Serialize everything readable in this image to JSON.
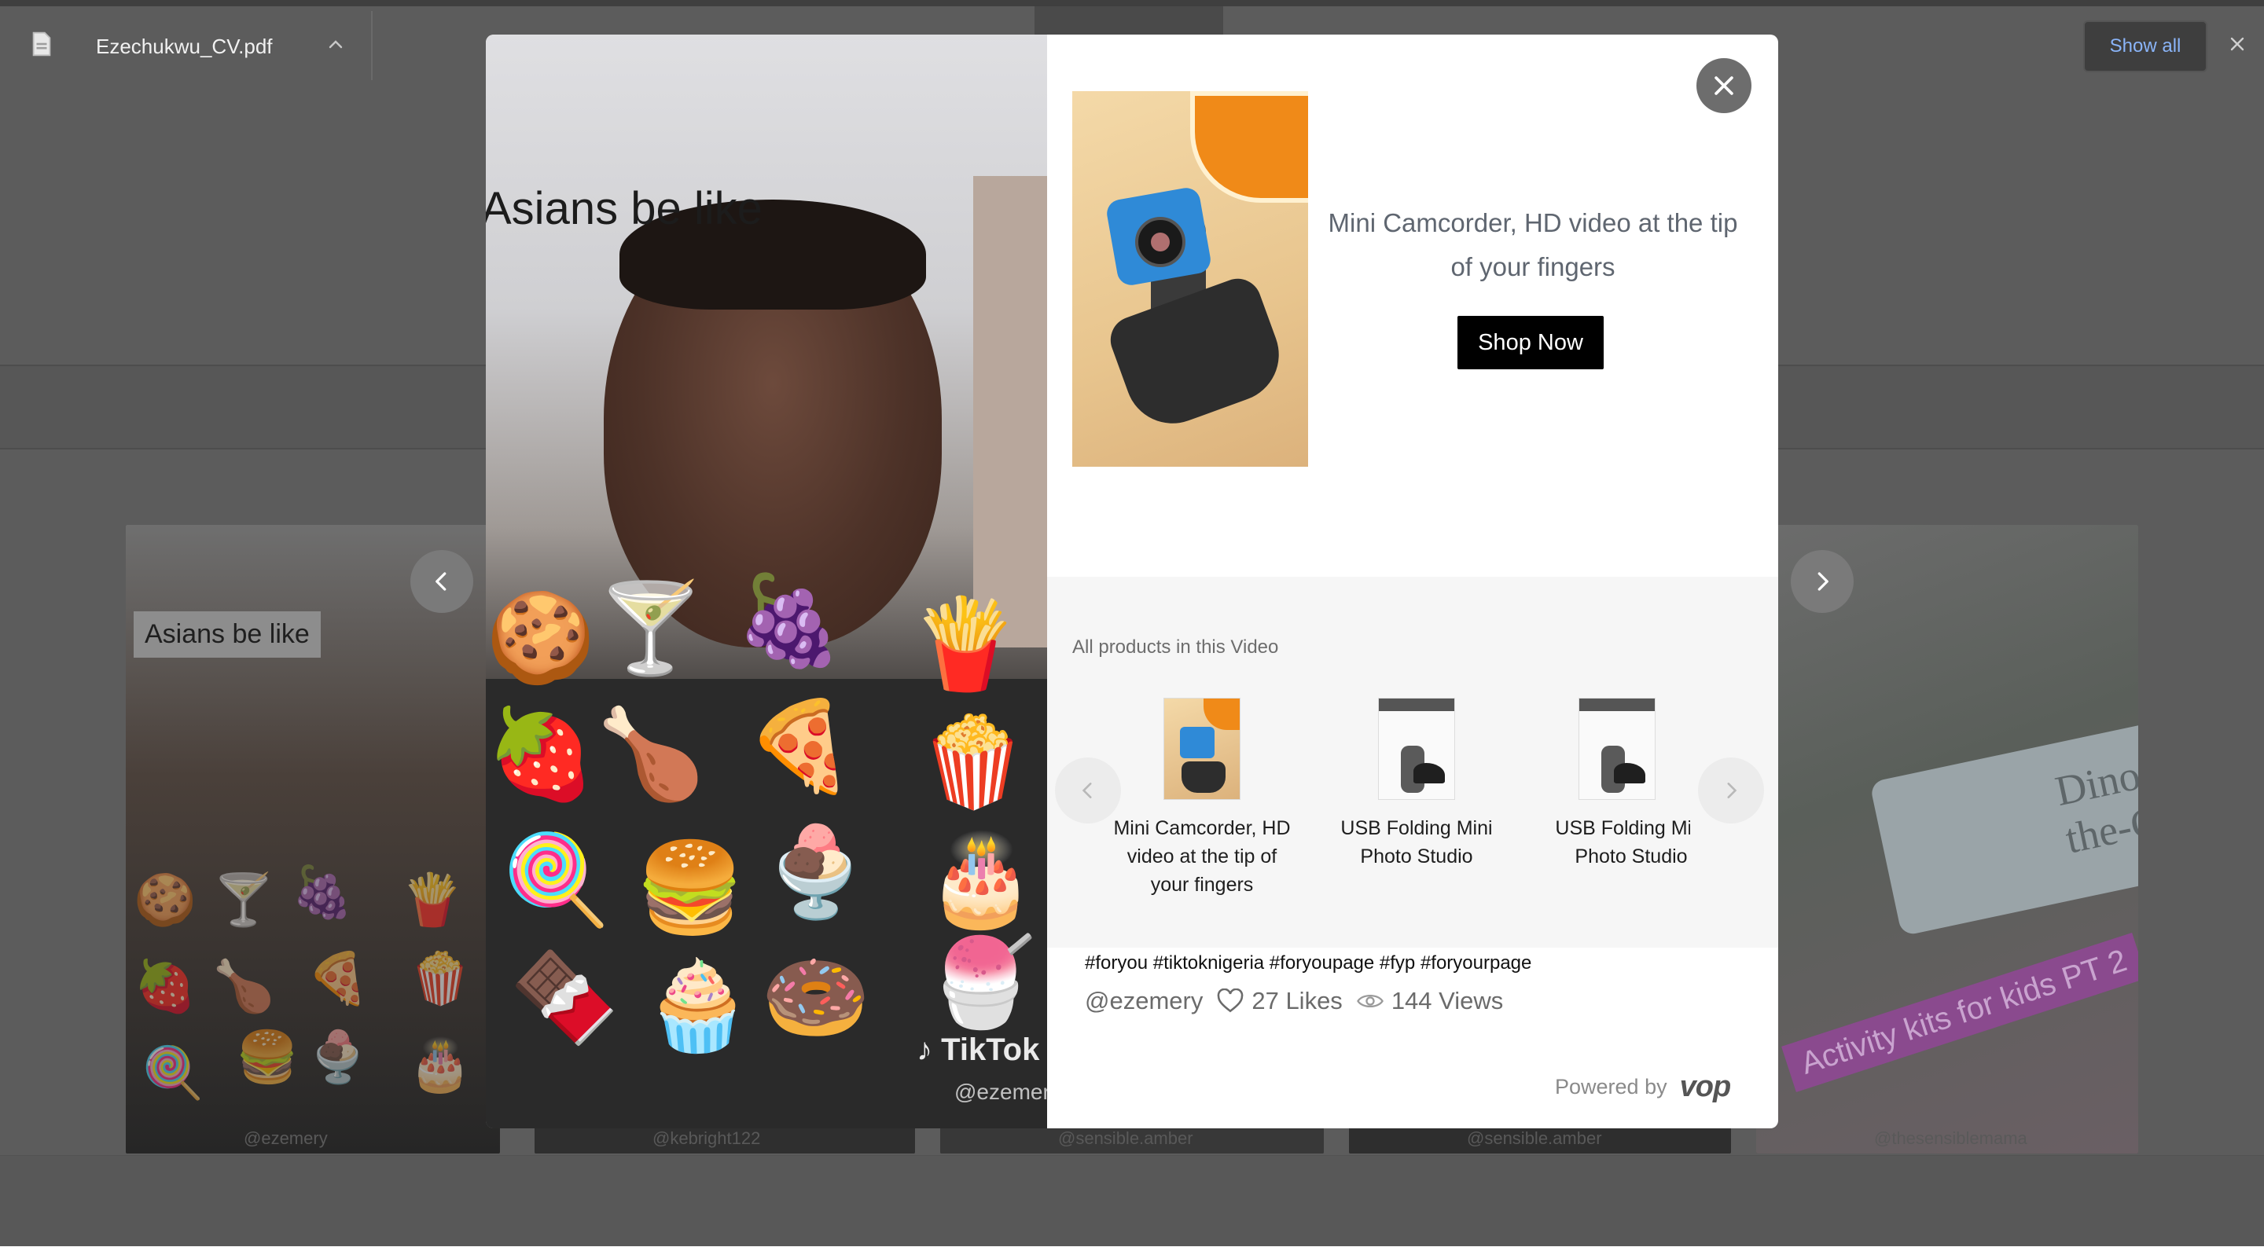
{
  "background_cards": [
    {
      "caption": "Asians be like",
      "footer": "@ezemery"
    },
    {
      "footer": "@kebright122"
    },
    {
      "footer": "@sensible.amber"
    },
    {
      "footer": "@sensible.amber"
    },
    {
      "footer": "@thesensiblemama",
      "overlay_text": "Activity kits for kids PT 2",
      "product_text": "Dino On-the-Go!"
    }
  ],
  "video": {
    "caption": "Asians be like",
    "watermark": "TikTok",
    "watermark_user": "@ezemery",
    "food_emojis": [
      "🍪",
      "🍸",
      "🍇",
      "🍟",
      "🍓",
      "🍗",
      "🍕",
      "🍿",
      "🍭",
      "🍔",
      "🍨",
      "🎂",
      "🍫",
      "🧁",
      "🍩",
      "🍧"
    ]
  },
  "product": {
    "title": "Mini Camcorder, HD video at the tip of your fingers",
    "cta": "Shop Now"
  },
  "products_strip": {
    "label": "All products in this Video",
    "items": [
      {
        "name": "Mini Camcorder, HD video at the tip of your fingers"
      },
      {
        "name": "USB Folding Mini Photo Studio"
      },
      {
        "name": "USB Folding Mini Photo Studio"
      }
    ]
  },
  "post": {
    "hashtags": "#foryou #tiktoknigeria #foryoupage #fyp #foryourpage",
    "user": "@ezemery",
    "likes": "27 Likes",
    "views": "144 Views"
  },
  "branding": {
    "powered_by": "Powered by",
    "logo": "vop"
  },
  "download_bar": {
    "file_name": "Ezechukwu_CV.pdf",
    "show_all": "Show all"
  },
  "colors": {
    "accent_link": "#1a73e8",
    "cta_bg": "#000000",
    "overlay": "#5c5c5c"
  }
}
